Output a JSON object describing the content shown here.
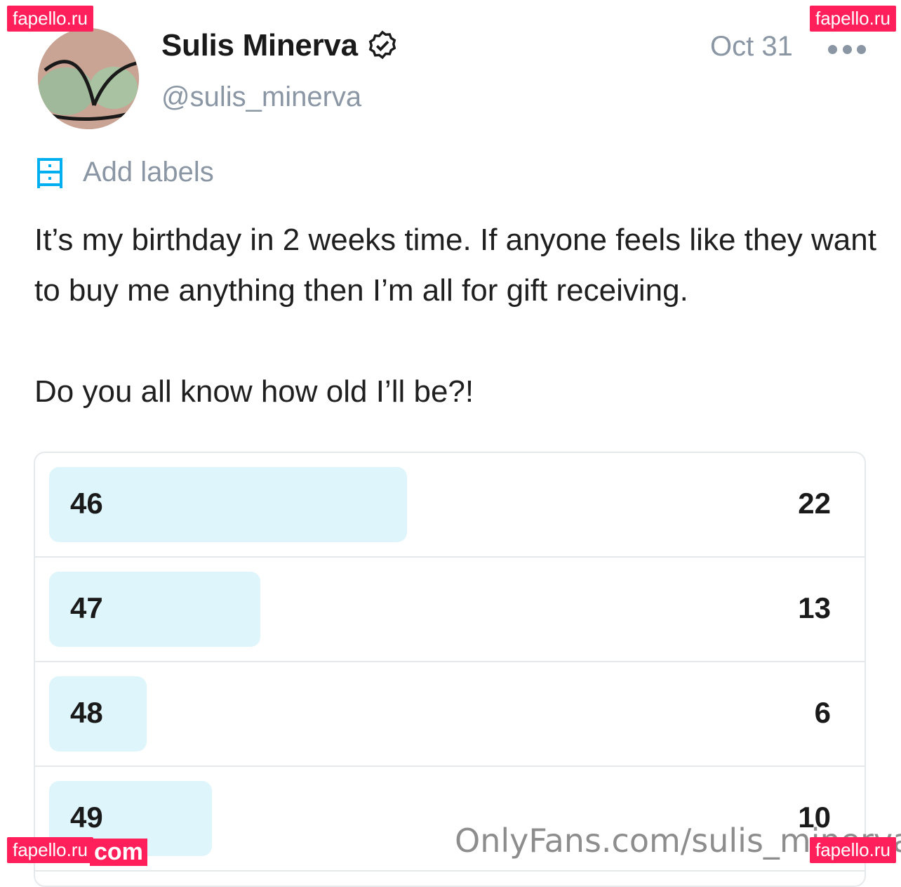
{
  "post": {
    "author_name": "Sulis Minerva",
    "handle": "@sulis_minerva",
    "date": "Oct 31",
    "labels_text": "Add labels",
    "text_line1": "It’s my birthday in 2 weeks time. If anyone feels like they want to buy me anything then I’m all for gift receiving.",
    "question": "Do you all know how old I’ll be?!"
  },
  "poll": {
    "options": [
      {
        "label": "46",
        "count": "22",
        "fill": 0.435
      },
      {
        "label": "47",
        "count": "13",
        "fill": 0.257
      },
      {
        "label": "48",
        "count": "6",
        "fill": 0.119
      },
      {
        "label": "49",
        "count": "10",
        "fill": 0.198
      }
    ]
  },
  "watermarks": {
    "site": "fapello.ru",
    "onlyfans": "OnlyFans.com/sulis_minerva",
    "com": "com"
  },
  "colors": {
    "accent": "#00aff0",
    "bar_fill": "#def5fb",
    "muted_text": "#8a96a3",
    "watermark_bg": "#ff1f5a"
  },
  "icons": [
    "verified-badge-icon",
    "more-options-icon",
    "labels-icon",
    "avatar"
  ]
}
